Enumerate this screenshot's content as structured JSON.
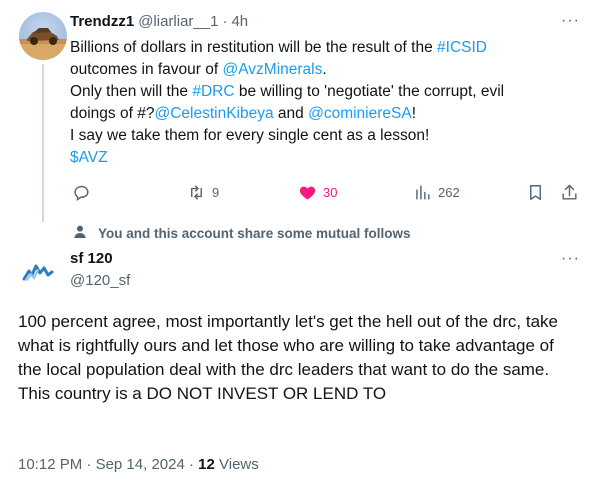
{
  "tweet": {
    "author_name": "Trendzz1",
    "handle": "@liarliar__1",
    "time": "4h",
    "more_label": "···",
    "text": {
      "l1_a": "Billions of dollars in restitution will be the result of the ",
      "l1_tag": "#ICSID",
      "l2_a": "outcomes in favour of ",
      "l2_mention": "@AvzMinerals",
      "l2_b": ".",
      "l3_a": "Only then will the ",
      "l3_tag": "#DRC",
      "l3_b": " be willing to 'negotiate' the corrupt, evil",
      "l4_a": "doings of #?",
      "l4_mention1": "@CelestinKibeya",
      "l4_b": " and ",
      "l4_mention2": "@cominiereSA",
      "l4_c": "!",
      "l5": "I say we take them for every single cent as a lesson!",
      "l6_cashtag": "$AVZ"
    },
    "actions": {
      "reply_count": "",
      "retweet_count": "9",
      "like_count": "30",
      "views_count": "262"
    },
    "like_color": "#f91880",
    "link_color": "#1d9bf0"
  },
  "social_context": "You and this account share some mutual follows",
  "reply": {
    "author_name": "sf 120",
    "handle": "@120_sf",
    "more_label": "···",
    "text": "100 percent agree, most importantly let's get the hell out of the drc, take what is rightfully ours and let those who are willing to take advantage of the local population deal with the drc leaders that want to do the same. This country is a DO NOT INVEST OR LEND TO",
    "time": "10:12 PM",
    "date": "Sep 14, 2024",
    "views_count": "12",
    "views_label": "Views"
  }
}
